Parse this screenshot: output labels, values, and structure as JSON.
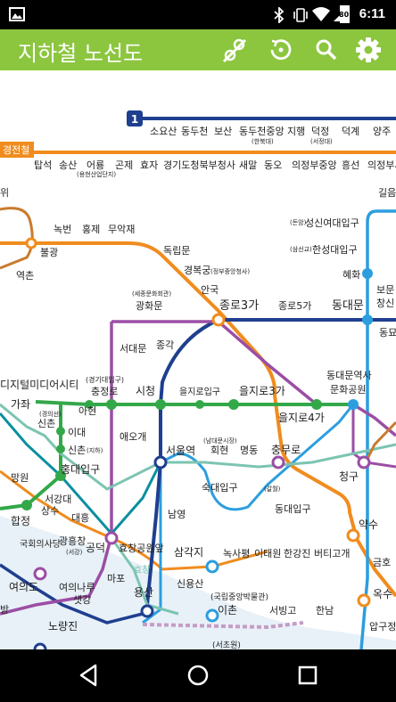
{
  "statusbar": {
    "time": "6:11",
    "battery": "80"
  },
  "appbar": {
    "title": "지하철 노선도"
  },
  "colors": {
    "line1": "#1f3f8f",
    "line2": "#33a849",
    "line3": "#f08c1e",
    "line4": "#2c9ede",
    "line5": "#9b4ea5",
    "line6": "#c77c2e",
    "line_gyeongui": "#7cc4b2",
    "line_airport": "#0a8fa0",
    "appbar": "#8cc63f"
  },
  "map": {
    "line1_badge": "1",
    "gyeongwon_label": "경전철",
    "stations": {
      "soyosan": "소요산",
      "dongducheon": "동두천",
      "bosan": "보산",
      "dongducheon_jungang": "동두천중앙",
      "dongducheon_jungang_sub": "(한북대)",
      "jihaeng": "지행",
      "deokjeong": "덕정",
      "deokjeong_sub": "(서정대)",
      "deokgye": "덕계",
      "yangju": "양주",
      "tapseok": "탑석",
      "songsan": "송산",
      "eoryong": "어룡",
      "eoryong_sub": "(용현산업단지)",
      "gonje": "곤제",
      "hyoja": "효자",
      "gyeonggi_docheong": "경기도청북부청사",
      "saemal": "새말",
      "dongo": "동오",
      "uijeongbu_jungang": "의정부중앙",
      "heungseon": "흥선",
      "uijeongbu_si": "의정부시",
      "wi": "위",
      "gileum": "길음",
      "nokbeon": "녹번",
      "hongje": "홍제",
      "muakjae": "무악재",
      "bulgwang": "불광",
      "yeokchon": "역촌",
      "seongsin": "성신여대입구",
      "seongsin_sub": "(돈암)",
      "hansung": "한성대입구",
      "hansung_sub": "(삼선교)",
      "dongnimmun": "독립문",
      "gyeongbokgung": "경복궁",
      "gyeongbokgung_sub": "(정부중앙청사)",
      "anguk": "안국",
      "hyehwa": "혜화",
      "bomun": "보문",
      "changsin": "창신",
      "gwanghwamun": "광화문",
      "gwanghwamun_sub": "(세종문화회관)",
      "jongno3ga": "종로3가",
      "jongno5ga": "종로5가",
      "dongdaemun": "동대문",
      "dongmyo": "동묘",
      "seodaemun": "서대문",
      "jonggak": "종각",
      "ddp": "동대문역사",
      "ddp2": "문화공원",
      "digital": "디지털미디어시티",
      "gajwa": "가좌",
      "gyeonggidae_sub": "(경기대입구)",
      "chungjeongno": "충정로",
      "sicheong": "시청",
      "euljiro1ga": "을지로입구",
      "euljiro3ga": "을지로3가",
      "euljiro4ga": "을지로4가",
      "sinchon_gyeongui": "신촌",
      "sinchon_gyeongui_sub": "(경의선)",
      "ahyeon": "아현",
      "idae": "이대",
      "sinchon": "신촌",
      "sinchon_sub": "(지하)",
      "aeogae": "애오개",
      "seoulyeok": "서울역",
      "hoehyeon": "회현",
      "hoehyeon_sub": "(남대문시장)",
      "myeongdong": "명동",
      "chungmuro": "충무로",
      "cheonggu": "청구",
      "hongdae": "홍대입구",
      "mangwon": "망원",
      "seogang": "서강대",
      "sangsu": "상수",
      "daeheung": "대흥",
      "hapjeong": "합정",
      "sookmyung": "숙대입구",
      "sookmyung_sub": "(갈월)",
      "dongdaeipgu": "동대입구",
      "gukhoe": "국회의사당",
      "gwangheungchang": "광흥창",
      "gwangheungchang_sub": "(서강)",
      "gongdeok": "공덕",
      "hyochang": "효창공원앞",
      "namyeong": "남영",
      "samgakji": "삼각지",
      "noksapyeong": "녹사평",
      "itaewon": "이태원",
      "hangangjin": "한강진",
      "beotigogae": "버티고개",
      "yaksu": "약수",
      "geumho": "금호",
      "mapo": "마포",
      "hyochang2": "효창",
      "yeouido": "여의도",
      "yeouinaru": "여의나루",
      "saetgang": "샛강",
      "yongsan": "용산",
      "sinyongsan": "신용산",
      "ichon": "이촌",
      "ichon_sub": "(국립중앙박물관)",
      "seobinggo": "서빙고",
      "hannam": "한남",
      "oksu": "옥수",
      "apgujeong": "압구정",
      "bang": "방",
      "noryangjin": "노량진",
      "seocho_sub": "(서초원)"
    }
  }
}
